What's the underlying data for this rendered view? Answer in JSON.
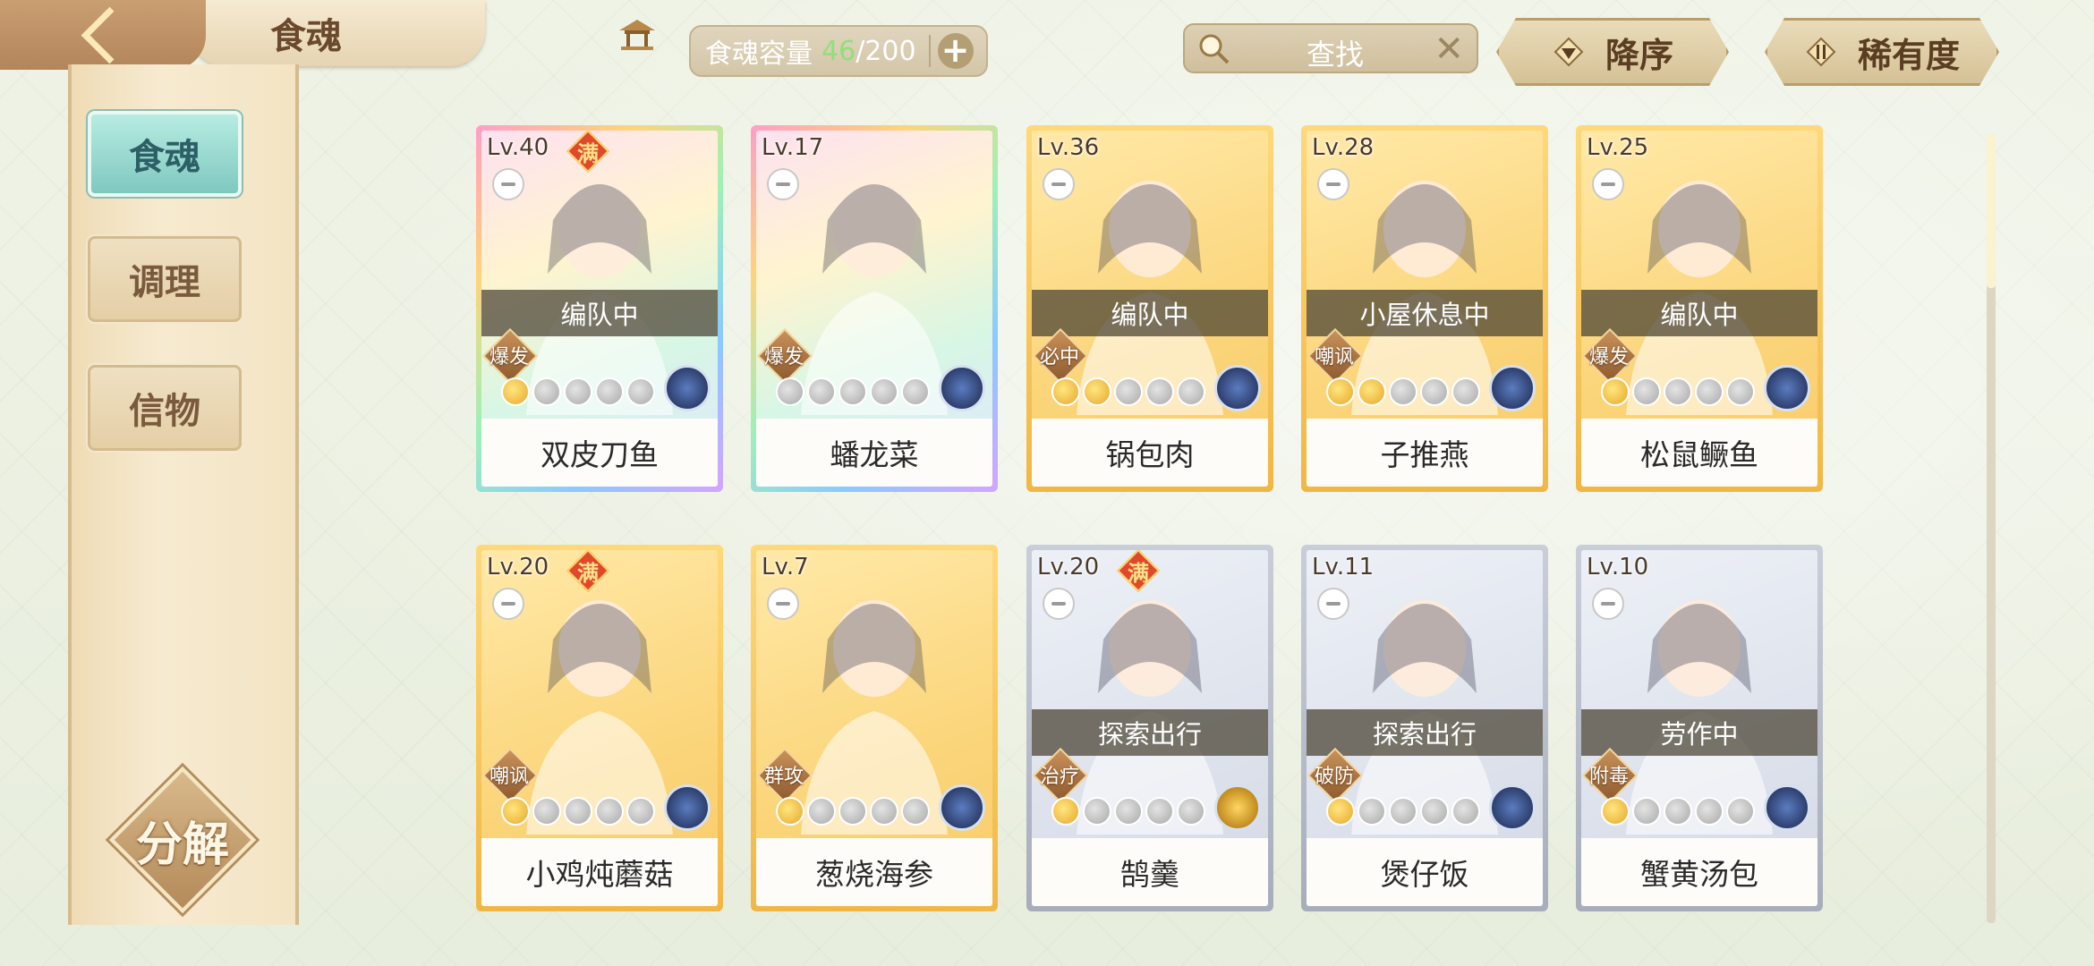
{
  "header": {
    "title": "食魂",
    "capacity_label": "食魂容量",
    "capacity_current": "46",
    "capacity_max": "/200",
    "search_placeholder": "查找",
    "sort_desc_label": "降序",
    "sort_rarity_label": "稀有度"
  },
  "sidebar": {
    "tabs": [
      {
        "label": "食魂",
        "active": true
      },
      {
        "label": "调理",
        "active": false
      },
      {
        "label": "信物",
        "active": false
      }
    ],
    "decompose_label": "分解"
  },
  "cards": [
    {
      "level": "Lv.40",
      "full": "满",
      "status": "编队中",
      "role": "爆发",
      "stars_on": 1,
      "stars_total": 5,
      "name": "双皮刀鱼",
      "frame": "rainbow"
    },
    {
      "level": "Lv.17",
      "full": "",
      "status": "",
      "role": "爆发",
      "stars_on": 0,
      "stars_total": 5,
      "name": "蟠龙菜",
      "frame": "rainbow"
    },
    {
      "level": "Lv.36",
      "full": "",
      "status": "编队中",
      "role": "必中",
      "stars_on": 2,
      "stars_total": 5,
      "name": "锅包肉",
      "frame": "gold"
    },
    {
      "level": "Lv.28",
      "full": "",
      "status": "小屋休息中",
      "role": "嘲讽",
      "stars_on": 2,
      "stars_total": 5,
      "name": "子推燕",
      "frame": "gold"
    },
    {
      "level": "Lv.25",
      "full": "",
      "status": "编队中",
      "role": "爆发",
      "stars_on": 1,
      "stars_total": 5,
      "name": "松鼠鳜鱼",
      "frame": "gold"
    },
    {
      "level": "Lv.20",
      "full": "满",
      "status": "",
      "role": "嘲讽",
      "stars_on": 1,
      "stars_total": 5,
      "name": "小鸡炖蘑菇",
      "frame": "gold"
    },
    {
      "level": "Lv.7",
      "full": "",
      "status": "",
      "role": "群攻",
      "stars_on": 1,
      "stars_total": 5,
      "name": "葱烧海参",
      "frame": "gold"
    },
    {
      "level": "Lv.20",
      "full": "满",
      "status": "探索出行",
      "role": "治疗",
      "stars_on": 1,
      "stars_total": 5,
      "name": "鹄羹",
      "frame": "silver"
    },
    {
      "level": "Lv.11",
      "full": "",
      "status": "探索出行",
      "role": "破防",
      "stars_on": 1,
      "stars_total": 5,
      "name": "煲仔饭",
      "frame": "silver"
    },
    {
      "level": "Lv.10",
      "full": "",
      "status": "劳作中",
      "role": "附毒",
      "stars_on": 1,
      "stars_total": 5,
      "name": "蟹黄汤包",
      "frame": "silver"
    }
  ],
  "colors": {
    "accent_teal": "#7fc8c0",
    "capacity_green": "#8ee07b",
    "sidebar_tan": "#f3e4c3"
  }
}
